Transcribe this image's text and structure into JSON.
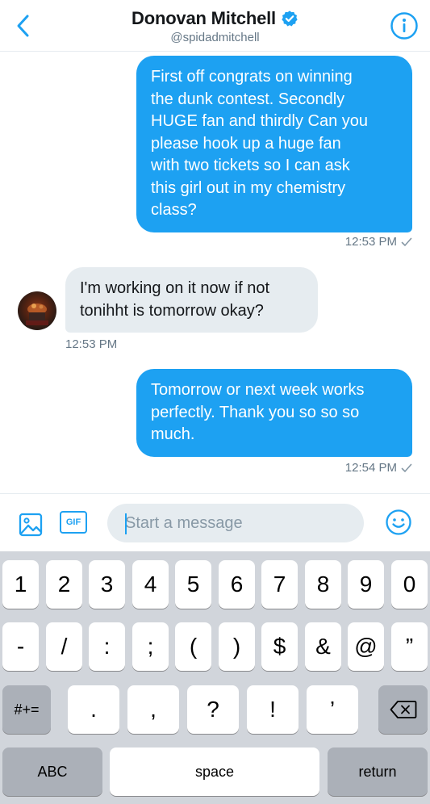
{
  "header": {
    "back_icon": "chevron-left-icon",
    "name": "Donovan Mitchell",
    "verified_icon": "verified-badge-icon",
    "handle": "@spidadmitchell",
    "info_icon": "info-icon",
    "accent": "#1da1f2"
  },
  "messages": [
    {
      "direction": "out",
      "text": "First off congrats on winning\nthe dunk contest. Secondly\nHUGE fan and thirdly Can you\nplease hook up a huge fan\nwith two tickets so I can ask\nthis girl out in my chemistry\nclass?",
      "time": "12:53 PM"
    },
    {
      "direction": "in",
      "text": "I'm working on it now if not\ntonihht is tomorrow okay?",
      "time": "12:53 PM"
    },
    {
      "direction": "out",
      "text": "Tomorrow or next week works\nperfectly. Thank you so so so\nmuch.",
      "time": "12:54 PM"
    }
  ],
  "composer": {
    "media_icon": "image-icon",
    "gif_label": "GIF",
    "placeholder": "Start a message",
    "emoji_icon": "smiley-icon"
  },
  "keyboard": {
    "row1": [
      "1",
      "2",
      "3",
      "4",
      "5",
      "6",
      "7",
      "8",
      "9",
      "0"
    ],
    "row2": [
      "-",
      "/",
      ":",
      ";",
      "(",
      ")",
      "$",
      "&",
      "@",
      "”"
    ],
    "row3": [
      "#+=",
      ".",
      ",",
      "?",
      "!",
      "’"
    ],
    "backspace_icon": "backspace-icon",
    "abc": "ABC",
    "space": "space",
    "return": "return"
  }
}
